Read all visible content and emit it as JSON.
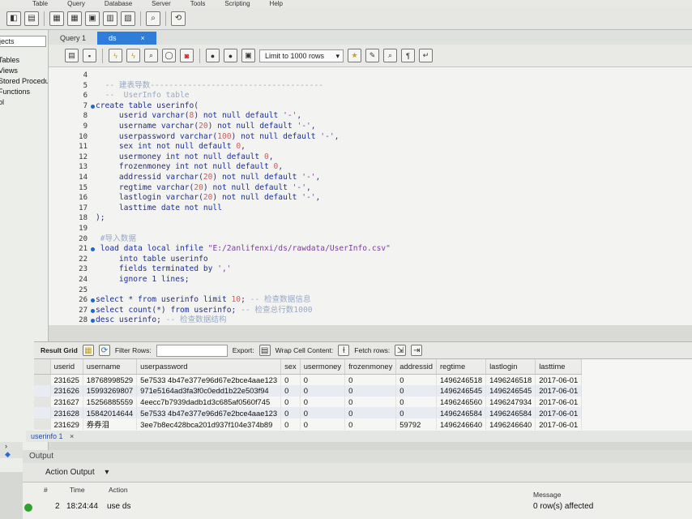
{
  "menu": [
    "Table",
    "Query",
    "Database",
    "Server",
    "Tools",
    "Scripting",
    "Help"
  ],
  "tabs": [
    {
      "label": "Query 1"
    },
    {
      "label": "ds",
      "close": "×"
    }
  ],
  "navigator": {
    "filter": "jects",
    "tree": [
      "Tables",
      "Views",
      "Stored Procedures",
      "Functions",
      "ol"
    ]
  },
  "query_toolbar": {
    "limit": "Limit to 1000 rows"
  },
  "editor": {
    "lines": [
      {
        "n": "4",
        "text": ""
      },
      {
        "n": "5",
        "text": "  -- 建表导数-------------------------------------"
      },
      {
        "n": "6",
        "text": "  --  UserInfo table"
      },
      {
        "n": "7",
        "text": "create table userinfo(",
        "marker": true
      },
      {
        "n": "8",
        "text": "     userid varchar(8) not null default '-',"
      },
      {
        "n": "9",
        "text": "     username varchar(20) not null default '-',"
      },
      {
        "n": "10",
        "text": "     userpassword varchar(100) not null default '-',"
      },
      {
        "n": "11",
        "text": "     sex int not null default 0,"
      },
      {
        "n": "12",
        "text": "     usermoney int not null default 0,"
      },
      {
        "n": "13",
        "text": "     frozenmoney int not null default 0,"
      },
      {
        "n": "14",
        "text": "     addressid varchar(20) not null default '-',"
      },
      {
        "n": "15",
        "text": "     regtime varchar(20) not null default '-',"
      },
      {
        "n": "16",
        "text": "     lastlogin varchar(20) not null default '-',"
      },
      {
        "n": "17",
        "text": "     lasttime date not null"
      },
      {
        "n": "18",
        "text": ");"
      },
      {
        "n": "19",
        "text": ""
      },
      {
        "n": "20",
        "text": " #导入数据"
      },
      {
        "n": "21",
        "text": " load data local infile \"E:/2anlifenxi/ds/rawdata/UserInfo.csv\"",
        "marker": true
      },
      {
        "n": "22",
        "text": "     into table userinfo"
      },
      {
        "n": "23",
        "text": "     fields terminated by ','"
      },
      {
        "n": "24",
        "text": "     ignore 1 lines;"
      },
      {
        "n": "25",
        "text": ""
      },
      {
        "n": "26",
        "text": "select * from userinfo limit 10; -- 检查数据信息",
        "marker": true
      },
      {
        "n": "27",
        "text": "select count(*) from userinfo; -- 检查总行数1000",
        "marker": true
      },
      {
        "n": "28",
        "text": "desc userinfo; -- 检查数据结构",
        "marker": true
      }
    ]
  },
  "result_toolbar": {
    "result_grid": "Result Grid",
    "filter_rows": "Filter Rows:",
    "export": "Export:",
    "wrap": "Wrap Cell Content:",
    "fetch": "Fetch rows:"
  },
  "result_table": {
    "columns": [
      "userid",
      "username",
      "userpassword",
      "sex",
      "usermoney",
      "frozenmoney",
      "addressid",
      "regtime",
      "lastlogin",
      "lasttime"
    ],
    "rows": [
      [
        "231625",
        "18768998529",
        "5e7533 4b47e377e96d67e2bce4aae123",
        "0",
        "0",
        "0",
        "0",
        "1496246518",
        "1496246518",
        "2017-06-01"
      ],
      [
        "231626",
        "15993269807",
        "971e5164ad3fa3f0c0edd1b22e503f94",
        "0",
        "0",
        "0",
        "0",
        "1496246545",
        "1496246545",
        "2017-06-01"
      ],
      [
        "231627",
        "15256885559",
        "4eecc7b7939dadb1d3c685af0560f745",
        "0",
        "0",
        "0",
        "0",
        "1496246560",
        "1496247934",
        "2017-06-01"
      ],
      [
        "231628",
        "15842014644",
        "5e7533 4b47e377e96d67e2bce4aae123",
        "0",
        "0",
        "0",
        "0",
        "1496246584",
        "1496246584",
        "2017-06-01"
      ],
      [
        "231629",
        "券券泪",
        "3ee7b8ec428bca201d937f104e374b89",
        "0",
        "0",
        "0",
        "59792",
        "1496246640",
        "1496246640",
        "2017-06-01"
      ]
    ]
  },
  "result_tab": {
    "label": "userinfo 1",
    "close": "×"
  },
  "output": {
    "title": "Output",
    "mode": "Action Output",
    "headers": {
      "idx": "#",
      "time": "Time",
      "action": "Action",
      "message": "Message"
    },
    "row": {
      "idx": "2",
      "time": "18:24:44",
      "action": "use ds",
      "message": "0 row(s) affected"
    }
  }
}
